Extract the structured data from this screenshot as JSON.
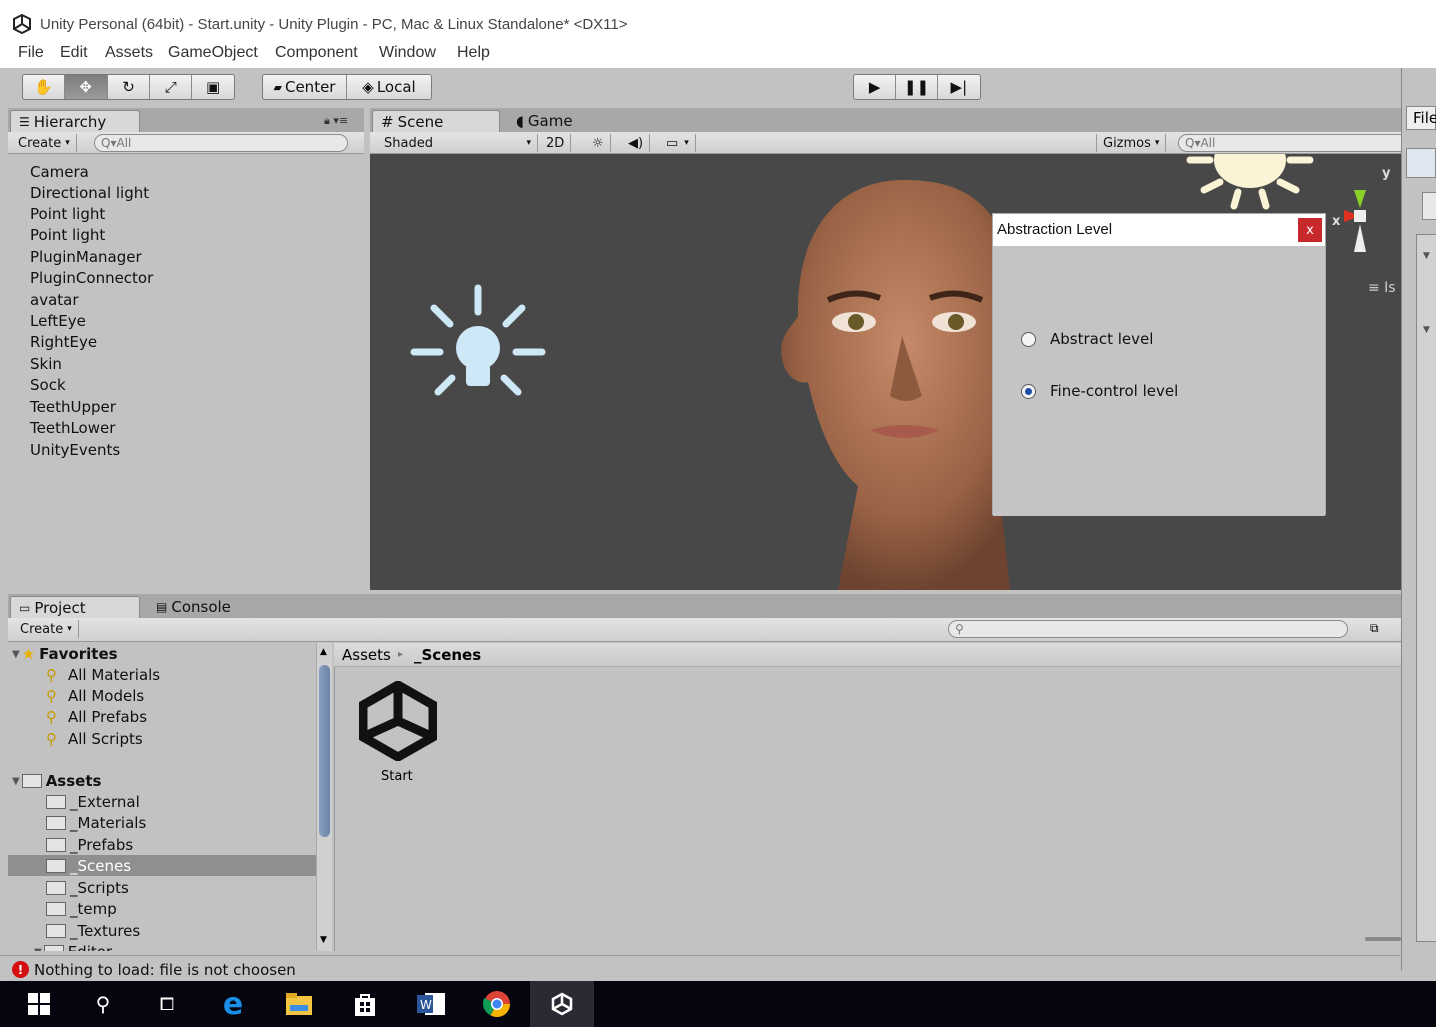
{
  "window": {
    "title": "Unity Personal (64bit) - Start.unity - Unity Plugin - PC, Mac & Linux Standalone* <DX11>"
  },
  "menu": [
    "File",
    "Edit",
    "Assets",
    "GameObject",
    "Component",
    "Window",
    "Help"
  ],
  "toolbar": {
    "pivot_label": "Center",
    "space_label": "Local"
  },
  "hierarchy": {
    "tab_label": "Hierarchy",
    "create_label": "Create",
    "search_placeholder": "Q▾All",
    "items": [
      "Camera",
      "Directional light",
      "Point light",
      "Point light",
      "PluginManager",
      "PluginConnector",
      "avatar",
      "LeftEye",
      "RightEye",
      "Skin",
      "Sock",
      "TeethUpper",
      "TeethLower",
      "UnityEvents"
    ]
  },
  "scene": {
    "scene_tab": "Scene",
    "game_tab": "Game",
    "shading_mode": "Shaded",
    "mode_2d": "2D",
    "gizmos_label": "Gizmos",
    "search_placeholder": "Q▾All",
    "gizmo_y": "y",
    "gizmo_x": "x",
    "persp_label": "≡ Is"
  },
  "dialog": {
    "title": "Abstraction Level",
    "close_label": "x",
    "options": [
      {
        "label": "Abstract level",
        "checked": false
      },
      {
        "label": "Fine-control level",
        "checked": true
      }
    ]
  },
  "project": {
    "project_tab": "Project",
    "console_tab": "Console",
    "create_label": "Create",
    "favorites_label": "Favorites",
    "favorites": [
      "All Materials",
      "All Models",
      "All Prefabs",
      "All Scripts"
    ],
    "assets_label": "Assets",
    "folders": [
      "_External",
      "_Materials",
      "_Prefabs",
      "_Scenes",
      "_Scripts",
      "_temp",
      "_Textures",
      "Editor"
    ],
    "selected_folder": "_Scenes",
    "breadcrumb_root": "Assets",
    "breadcrumb_current": "_Scenes",
    "asset_name": "Start"
  },
  "status": {
    "message": "Nothing to load: file is not choosen"
  },
  "inspector": {
    "file_label": "File"
  }
}
